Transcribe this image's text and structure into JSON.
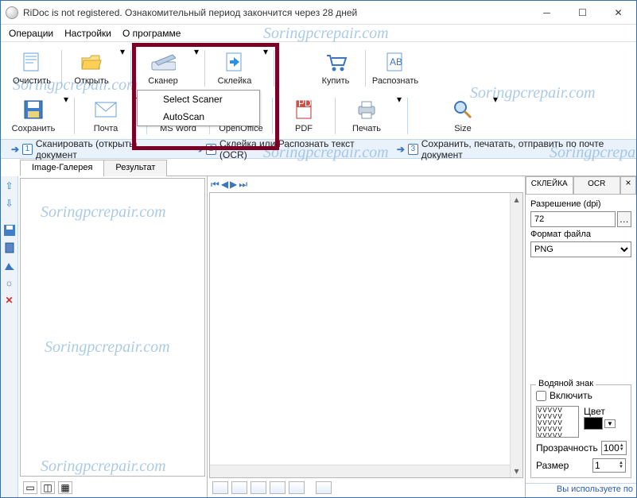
{
  "titlebar": {
    "title": "RiDoc is not registered. Ознакомительный период закончится через 28 дней"
  },
  "menu": {
    "ops": "Операции",
    "settings": "Настройки",
    "about": "О программе"
  },
  "toolbar": {
    "row1": {
      "clear": "Очистить",
      "open": "Открыть",
      "scan": "Сканер",
      "stitch": "Склейка",
      "buy": "Купить",
      "ocr": "Распознать"
    },
    "row2": {
      "save": "Сохранить",
      "mail": "Почта",
      "word": "MS Word",
      "oo": "OpenOffice",
      "pdf": "PDF",
      "print": "Печать",
      "size": "Size"
    }
  },
  "dropdown": {
    "select_scanner": "Select Scaner",
    "autoscan": "AutoScan"
  },
  "steps": {
    "s1": "Сканировать (открыть) документ",
    "s2": "Склейка или Распознать текст (OCR)",
    "s3": "Сохранить, печатать, отправить по почте документ"
  },
  "tabs": {
    "gallery": "Image-Галерея",
    "result": "Результат"
  },
  "right": {
    "tab_stitch": "СКЛЕЙКА",
    "tab_ocr": "OCR",
    "dpi_label": "Разрешение (dpi)",
    "dpi_value": "72",
    "fmt_label": "Формат файла",
    "fmt_value": "PNG",
    "wm_group": "Водяной знак",
    "wm_enable": "Включить",
    "color_label": "Цвет",
    "opacity_label": "Прозрачность",
    "opacity_value": "100",
    "size_label": "Размер",
    "size_value": "1"
  },
  "status": "Вы используете по",
  "watermark": "Soringpcrepair.com"
}
